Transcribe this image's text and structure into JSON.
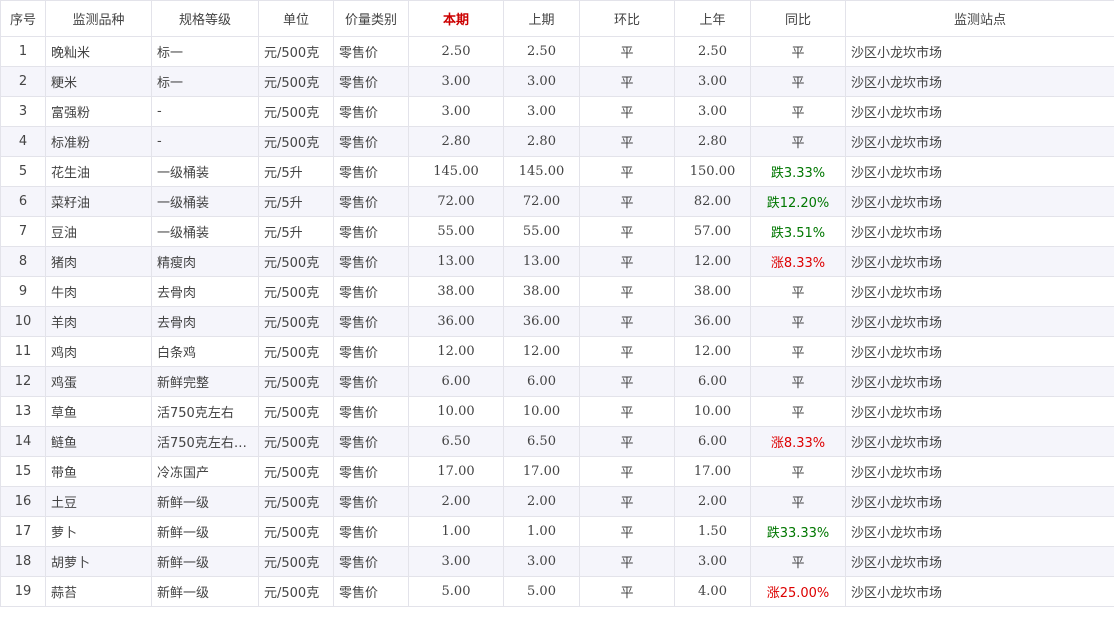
{
  "colors": {
    "accent": "#cc0000",
    "up": "#dd0000",
    "down": "#007700",
    "stripe": "#f5f5fb",
    "border": "#e3e3ea"
  },
  "headers": [
    "序号",
    "监测品种",
    "规格等级",
    "单位",
    "价量类别",
    "本期",
    "上期",
    "环比",
    "上年",
    "同比",
    "监测站点"
  ],
  "rows": [
    {
      "no": "1",
      "name": "晚籼米",
      "spec": "标一",
      "unit": "元/500克",
      "cat": "零售价",
      "cur": "2.50",
      "prev": "2.50",
      "mom": "平",
      "ly": "2.50",
      "yoy": "平",
      "yoy_trend": "flat",
      "site": "沙区小龙坎市场"
    },
    {
      "no": "2",
      "name": "粳米",
      "spec": "标一",
      "unit": "元/500克",
      "cat": "零售价",
      "cur": "3.00",
      "prev": "3.00",
      "mom": "平",
      "ly": "3.00",
      "yoy": "平",
      "yoy_trend": "flat",
      "site": "沙区小龙坎市场"
    },
    {
      "no": "3",
      "name": "富强粉",
      "spec": "-",
      "unit": "元/500克",
      "cat": "零售价",
      "cur": "3.00",
      "prev": "3.00",
      "mom": "平",
      "ly": "3.00",
      "yoy": "平",
      "yoy_trend": "flat",
      "site": "沙区小龙坎市场"
    },
    {
      "no": "4",
      "name": "标准粉",
      "spec": "-",
      "unit": "元/500克",
      "cat": "零售价",
      "cur": "2.80",
      "prev": "2.80",
      "mom": "平",
      "ly": "2.80",
      "yoy": "平",
      "yoy_trend": "flat",
      "site": "沙区小龙坎市场"
    },
    {
      "no": "5",
      "name": "花生油",
      "spec": "一级桶装",
      "unit": "元/5升",
      "cat": "零售价",
      "cur": "145.00",
      "prev": "145.00",
      "mom": "平",
      "ly": "150.00",
      "yoy": "跌3.33%",
      "yoy_trend": "down",
      "site": "沙区小龙坎市场"
    },
    {
      "no": "6",
      "name": "菜籽油",
      "spec": "一级桶装",
      "unit": "元/5升",
      "cat": "零售价",
      "cur": "72.00",
      "prev": "72.00",
      "mom": "平",
      "ly": "82.00",
      "yoy": "跌12.20%",
      "yoy_trend": "down",
      "site": "沙区小龙坎市场"
    },
    {
      "no": "7",
      "name": "豆油",
      "spec": "一级桶装",
      "unit": "元/5升",
      "cat": "零售价",
      "cur": "55.00",
      "prev": "55.00",
      "mom": "平",
      "ly": "57.00",
      "yoy": "跌3.51%",
      "yoy_trend": "down",
      "site": "沙区小龙坎市场"
    },
    {
      "no": "8",
      "name": "猪肉",
      "spec": "精瘦肉",
      "unit": "元/500克",
      "cat": "零售价",
      "cur": "13.00",
      "prev": "13.00",
      "mom": "平",
      "ly": "12.00",
      "yoy": "涨8.33%",
      "yoy_trend": "up",
      "site": "沙区小龙坎市场"
    },
    {
      "no": "9",
      "name": "牛肉",
      "spec": "去骨肉",
      "unit": "元/500克",
      "cat": "零售价",
      "cur": "38.00",
      "prev": "38.00",
      "mom": "平",
      "ly": "38.00",
      "yoy": "平",
      "yoy_trend": "flat",
      "site": "沙区小龙坎市场"
    },
    {
      "no": "10",
      "name": "羊肉",
      "spec": "去骨肉",
      "unit": "元/500克",
      "cat": "零售价",
      "cur": "36.00",
      "prev": "36.00",
      "mom": "平",
      "ly": "36.00",
      "yoy": "平",
      "yoy_trend": "flat",
      "site": "沙区小龙坎市场"
    },
    {
      "no": "11",
      "name": "鸡肉",
      "spec": "白条鸡",
      "unit": "元/500克",
      "cat": "零售价",
      "cur": "12.00",
      "prev": "12.00",
      "mom": "平",
      "ly": "12.00",
      "yoy": "平",
      "yoy_trend": "flat",
      "site": "沙区小龙坎市场"
    },
    {
      "no": "12",
      "name": "鸡蛋",
      "spec": "新鲜完整",
      "unit": "元/500克",
      "cat": "零售价",
      "cur": "6.00",
      "prev": "6.00",
      "mom": "平",
      "ly": "6.00",
      "yoy": "平",
      "yoy_trend": "flat",
      "site": "沙区小龙坎市场"
    },
    {
      "no": "13",
      "name": "草鱼",
      "spec": "活750克左右",
      "unit": "元/500克",
      "cat": "零售价",
      "cur": "10.00",
      "prev": "10.00",
      "mom": "平",
      "ly": "10.00",
      "yoy": "平",
      "yoy_trend": "flat",
      "site": "沙区小龙坎市场"
    },
    {
      "no": "14",
      "name": "鲢鱼",
      "spec": "活750克左右…",
      "unit": "元/500克",
      "cat": "零售价",
      "cur": "6.50",
      "prev": "6.50",
      "mom": "平",
      "ly": "6.00",
      "yoy": "涨8.33%",
      "yoy_trend": "up",
      "site": "沙区小龙坎市场"
    },
    {
      "no": "15",
      "name": "带鱼",
      "spec": "冷冻国产",
      "unit": "元/500克",
      "cat": "零售价",
      "cur": "17.00",
      "prev": "17.00",
      "mom": "平",
      "ly": "17.00",
      "yoy": "平",
      "yoy_trend": "flat",
      "site": "沙区小龙坎市场"
    },
    {
      "no": "16",
      "name": "土豆",
      "spec": "新鲜一级",
      "unit": "元/500克",
      "cat": "零售价",
      "cur": "2.00",
      "prev": "2.00",
      "mom": "平",
      "ly": "2.00",
      "yoy": "平",
      "yoy_trend": "flat",
      "site": "沙区小龙坎市场"
    },
    {
      "no": "17",
      "name": "萝卜",
      "spec": "新鲜一级",
      "unit": "元/500克",
      "cat": "零售价",
      "cur": "1.00",
      "prev": "1.00",
      "mom": "平",
      "ly": "1.50",
      "yoy": "跌33.33%",
      "yoy_trend": "down",
      "site": "沙区小龙坎市场"
    },
    {
      "no": "18",
      "name": "胡萝卜",
      "spec": "新鲜一级",
      "unit": "元/500克",
      "cat": "零售价",
      "cur": "3.00",
      "prev": "3.00",
      "mom": "平",
      "ly": "3.00",
      "yoy": "平",
      "yoy_trend": "flat",
      "site": "沙区小龙坎市场"
    },
    {
      "no": "19",
      "name": "蒜苔",
      "spec": "新鲜一级",
      "unit": "元/500克",
      "cat": "零售价",
      "cur": "5.00",
      "prev": "5.00",
      "mom": "平",
      "ly": "4.00",
      "yoy": "涨25.00%",
      "yoy_trend": "up",
      "site": "沙区小龙坎市场"
    }
  ]
}
